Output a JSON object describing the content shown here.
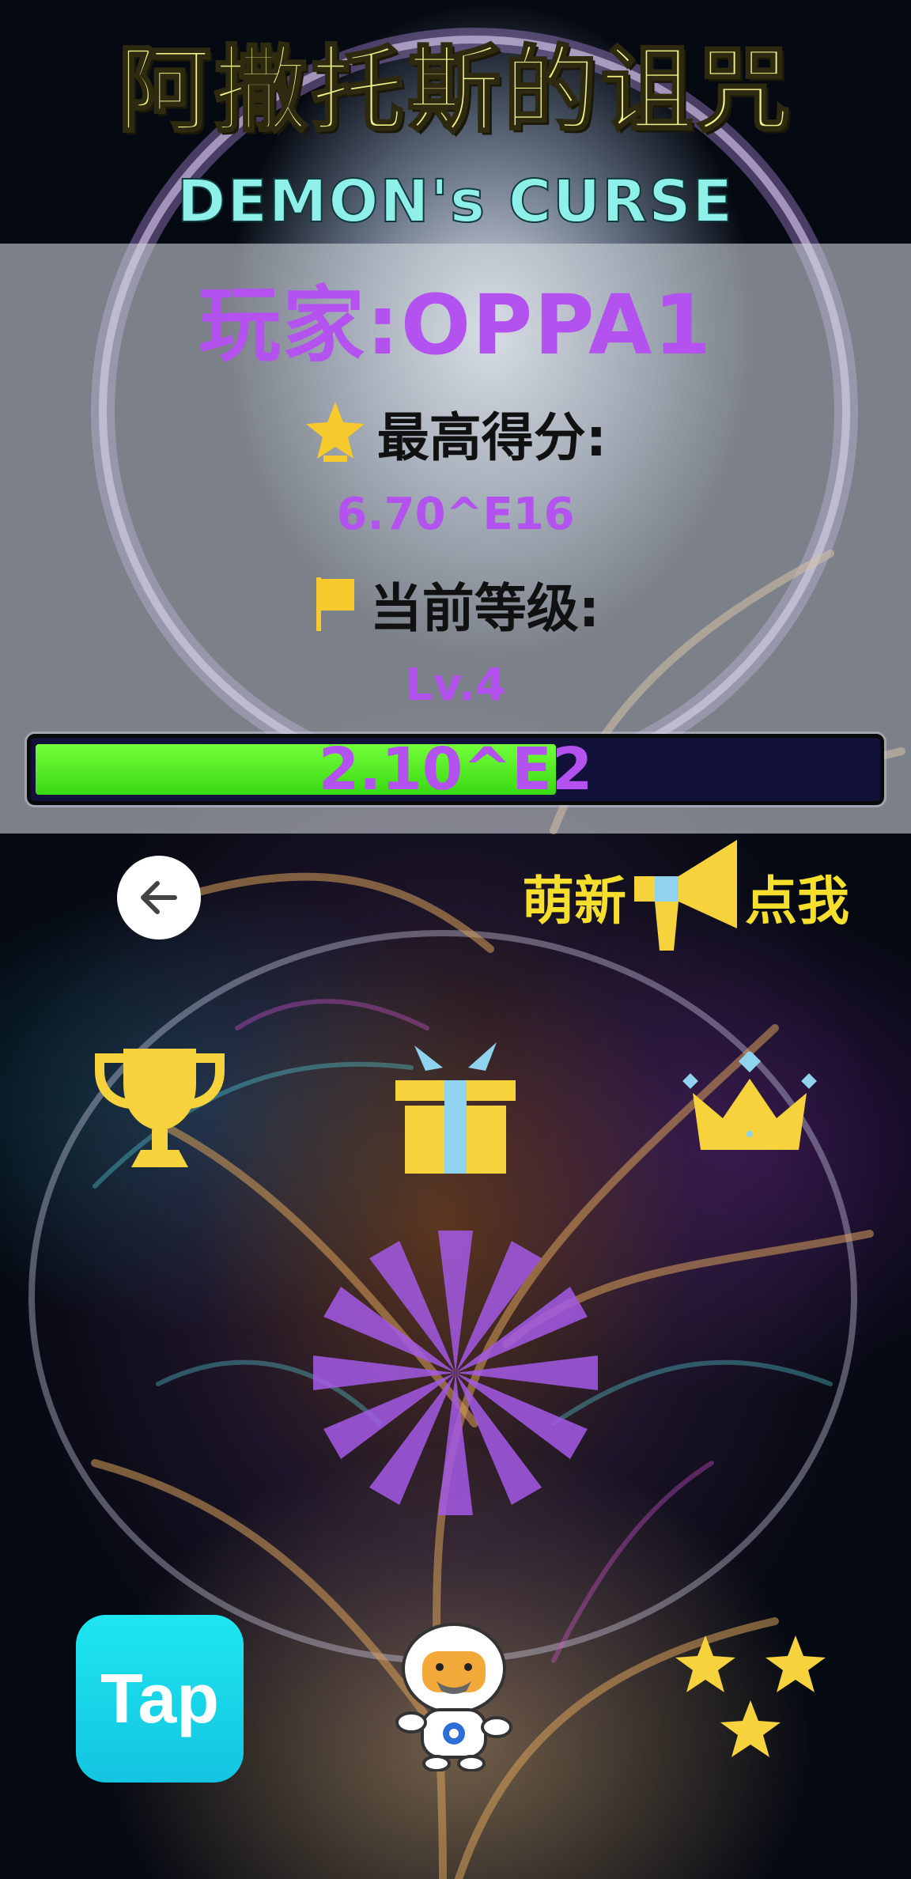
{
  "title": {
    "chinese": "阿撒托斯的诅咒",
    "english": "DEMON's CURSE"
  },
  "player": {
    "label": "玩家:OPPA1"
  },
  "stats": {
    "high_score_label": "最高得分:",
    "high_score_value": "6.70^E16",
    "level_label": "当前等级:",
    "level_value": "Lv.4"
  },
  "progress": {
    "text": "2.10^E2",
    "fraction": 0.62
  },
  "newbie": {
    "left_label": "萌新",
    "right_label": "点我"
  },
  "buttons": {
    "tap_label": "Tap"
  },
  "icons": {
    "star": "star-icon",
    "flag": "flag-icon",
    "back": "back-arrow-icon",
    "megaphone": "megaphone-icon",
    "trophy": "trophy-icon",
    "gift": "gift-icon",
    "crown": "crown-icon",
    "spin": "spin-icon",
    "astronaut": "astronaut-icon",
    "stars": "rating-stars-icon"
  },
  "colors": {
    "accent_purple": "#b352ee",
    "yellow": "#f6d23c",
    "progress_green": "#4ee81f",
    "progress_track": "#11113a",
    "title_yellow": "#f2ef8a",
    "title_cyan": "#8ff0ea"
  }
}
